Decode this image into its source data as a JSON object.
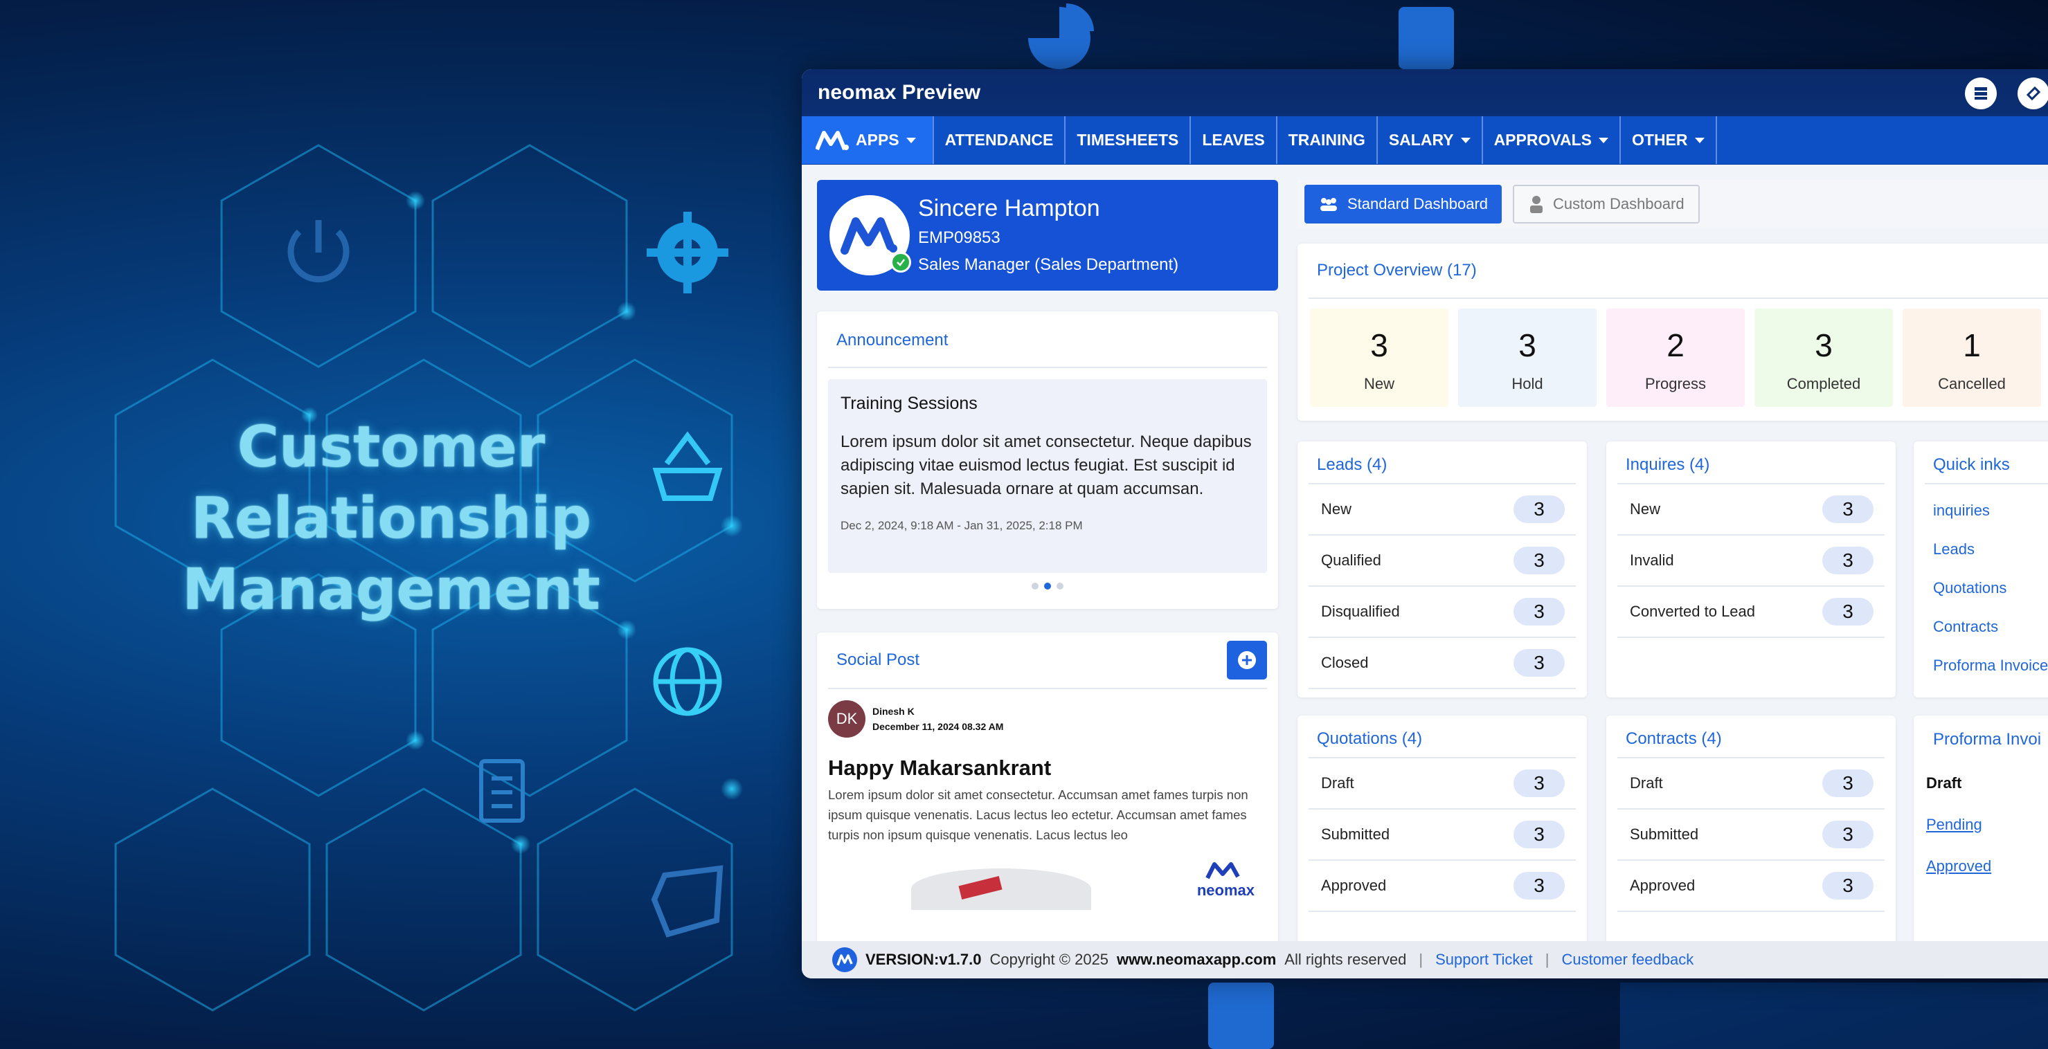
{
  "hero": {
    "line1": "Customer",
    "line2": "Relationship",
    "line3": "Management"
  },
  "app": {
    "title": "neomax Preview",
    "nav": [
      {
        "label": "APPS",
        "dropdown": true
      },
      {
        "label": "ATTENDANCE"
      },
      {
        "label": "TIMESHEETS"
      },
      {
        "label": "LEAVES"
      },
      {
        "label": "TRAINING"
      },
      {
        "label": "SALARY",
        "dropdown": true
      },
      {
        "label": "APPROVALS",
        "dropdown": true
      },
      {
        "label": "OTHER",
        "dropdown": true
      }
    ]
  },
  "profile": {
    "name": "Sincere Hampton",
    "emp_id": "EMP09853",
    "role": "Sales Manager (Sales Department)"
  },
  "announcement": {
    "heading": "Announcement",
    "title": "Training Sessions",
    "body": "Lorem ipsum dolor sit amet consectetur. Neque dapibus adipiscing vitae euismod lectus feugiat. Est suscipit id sapien sit. Malesuada ornare at quam accumsan.",
    "date": "Dec 2, 2024, 9:18 AM - Jan 31, 2025, 2:18 PM"
  },
  "social": {
    "heading": "Social Post",
    "author_initials": "DK",
    "author": "Dinesh K",
    "posted": "December 11, 2024 08.32 AM",
    "title": "Happy Makarsankrant",
    "body": "Lorem ipsum dolor sit amet consectetur. Accumsan amet fames turpis non ipsum quisque venenatis. Lacus lectus leo ectetur. Accumsan amet fames turpis non ipsum quisque venenatis. Lacus lectus leo",
    "brand": "neomax"
  },
  "dashboard": {
    "standard": "Standard Dashboard",
    "custom": "Custom Dashboard"
  },
  "overview": {
    "heading": "Project Overview (17)",
    "stats": [
      {
        "value": "3",
        "label": "New",
        "color": "#fffbea"
      },
      {
        "value": "3",
        "label": "Hold",
        "color": "#eef4fc"
      },
      {
        "value": "2",
        "label": "Progress",
        "color": "#fdeefa"
      },
      {
        "value": "3",
        "label": "Completed",
        "color": "#edfbe8"
      },
      {
        "value": "1",
        "label": "Cancelled",
        "color": "#fdf3ea"
      }
    ]
  },
  "leads": {
    "heading": "Leads (4)",
    "rows": [
      {
        "label": "New",
        "count": "3"
      },
      {
        "label": "Qualified",
        "count": "3"
      },
      {
        "label": "Disqualified",
        "count": "3"
      },
      {
        "label": "Closed",
        "count": "3"
      }
    ]
  },
  "inquires": {
    "heading": "Inquires (4)",
    "rows": [
      {
        "label": "New",
        "count": "3"
      },
      {
        "label": "Invalid",
        "count": "3"
      },
      {
        "label": "Converted to Lead",
        "count": "3"
      }
    ]
  },
  "quicklinks": {
    "heading": "Quick inks",
    "links": [
      "inquiries",
      "Leads",
      "Quotations",
      "Contracts",
      "Proforma Invoice"
    ]
  },
  "quotations": {
    "heading": "Quotations (4)",
    "rows": [
      {
        "label": "Draft",
        "count": "3"
      },
      {
        "label": "Submitted",
        "count": "3"
      },
      {
        "label": "Approved",
        "count": "3"
      }
    ]
  },
  "contracts": {
    "heading": "Contracts (4)",
    "rows": [
      {
        "label": "Draft",
        "count": "3"
      },
      {
        "label": "Submitted",
        "count": "3"
      },
      {
        "label": "Approved",
        "count": "3"
      }
    ]
  },
  "proforma": {
    "heading": "Proforma Invoi",
    "items": [
      "Draft",
      "Pending",
      "Approved"
    ]
  },
  "footer": {
    "version": "VERSION:v1.7.0",
    "copyright": "Copyright © 2025",
    "site": "www.neomaxapp.com",
    "rights": "All rights reserved",
    "support": "Support Ticket",
    "feedback": "Customer feedback"
  },
  "colors": {
    "primary": "#1e62e0",
    "nav": "#0d4fc4",
    "titlebar": "#0b2f74",
    "link": "#1f66d8"
  }
}
